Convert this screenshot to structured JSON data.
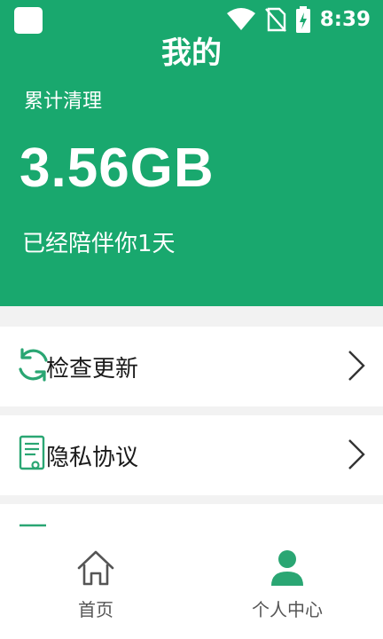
{
  "status": {
    "time": "8:39"
  },
  "header": {
    "title": "我的",
    "total_label": "累计清理",
    "total_value": "3.56GB",
    "companion_text": "已经陪伴你1天"
  },
  "menu": {
    "items": [
      {
        "label": "检查更新"
      },
      {
        "label": "隐私协议"
      }
    ]
  },
  "nav": {
    "items": [
      {
        "label": "首页"
      },
      {
        "label": "个人中心"
      }
    ]
  },
  "colors": {
    "brand": "#19a86e",
    "background": "#f2f2f2",
    "nav_active_icon": "#2aa673"
  },
  "icons": [
    "wifi-icon",
    "no-sim-icon",
    "battery-charging-icon",
    "refresh-icon",
    "document-icon",
    "chevron-right-icon",
    "home-icon",
    "person-icon"
  ]
}
